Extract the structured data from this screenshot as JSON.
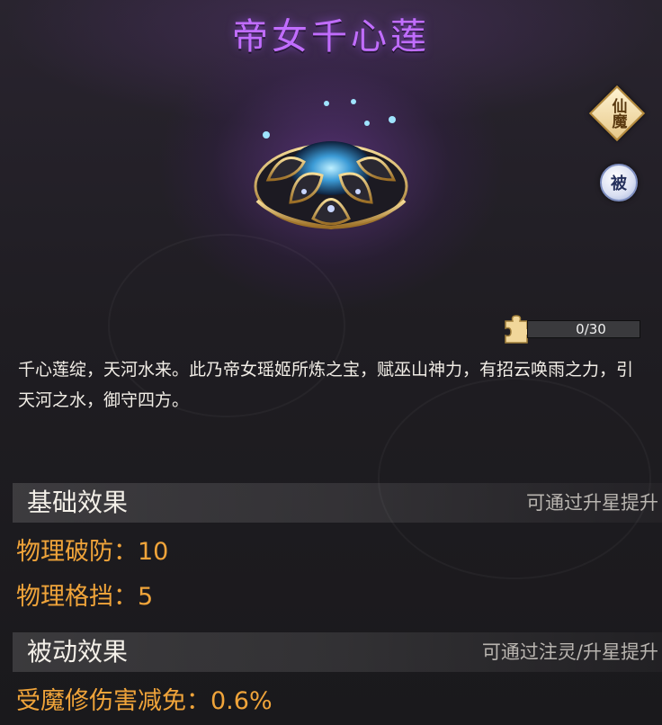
{
  "title": "帝女千心莲",
  "badges": {
    "realm": "仙魔",
    "passive": "被"
  },
  "shards": {
    "current": 0,
    "max": 30,
    "text": "0/30"
  },
  "description": "千心莲绽，天河水来。此乃帝女瑶姬所炼之宝，赋巫山神力，有招云唤雨之力，引天河之水，御守四方。",
  "sections": {
    "basic": {
      "title": "基础效果",
      "hint": "可通过升星提升",
      "effects": [
        "物理破防：10",
        "物理格挡：5"
      ]
    },
    "passive": {
      "title": "被动效果",
      "hint": "可通过注灵/升星提升",
      "effects": [
        "受魔修伤害减免：0.6%"
      ]
    }
  },
  "colors": {
    "title": "#c16dff",
    "effect_text": "#f0a43a",
    "progress_fill": "#6b8f3f"
  },
  "icons": {
    "item": "lotus-treasure-icon",
    "shard": "puzzle-piece-icon",
    "realm_badge": "diamond-badge-icon",
    "passive_badge": "circle-badge-icon"
  }
}
